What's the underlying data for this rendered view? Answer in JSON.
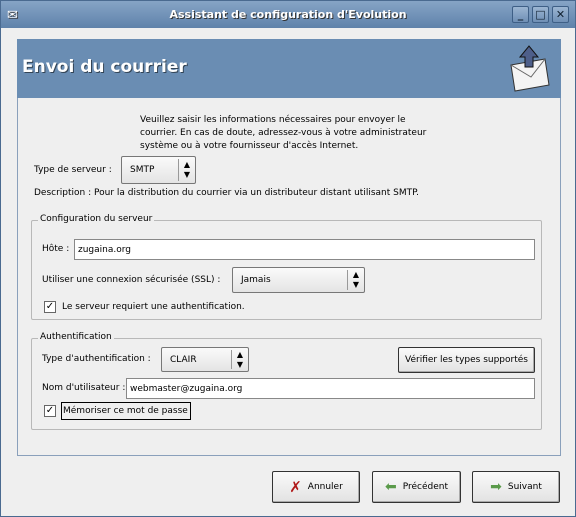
{
  "window": {
    "title": "Assistant de configuration d'Evolution",
    "minimize": "_",
    "maximize": "□",
    "close": "✕"
  },
  "header": {
    "title": "Envoi du courrier",
    "icon": "mail-send-icon"
  },
  "intro": [
    "Veuillez saisir les informations nécessaires pour envoyer le",
    "courrier.  En cas de doute, adressez-vous à votre administrateur",
    "système ou à votre fournisseur d'accès Internet."
  ],
  "server_type": {
    "label": "Type de serveur :",
    "value": "SMTP"
  },
  "description": "Description : Pour la distribution du courrier via un distributeur distant utilisant SMTP.",
  "server_config": {
    "title": "Configuration du serveur",
    "host_label": "Hôte :",
    "host_value": "zugaina.org",
    "ssl_label": "Utiliser une connexion sécurisée (SSL) :",
    "ssl_value": "Jamais",
    "auth_required_label": "Le serveur requiert une authentification.",
    "auth_required_checked": true
  },
  "auth": {
    "title": "Authentification",
    "type_label": "Type d'authentification :",
    "type_value": "CLAIR",
    "check_button": "Vérifier les types supportés",
    "user_label": "Nom d'utilisateur :",
    "user_value": "webmaster@zugaina.org",
    "remember_label": "Mémoriser ce mot de passe",
    "remember_checked": true
  },
  "buttons": {
    "cancel": "Annuler",
    "previous": "Précédent",
    "next": "Suivant"
  }
}
